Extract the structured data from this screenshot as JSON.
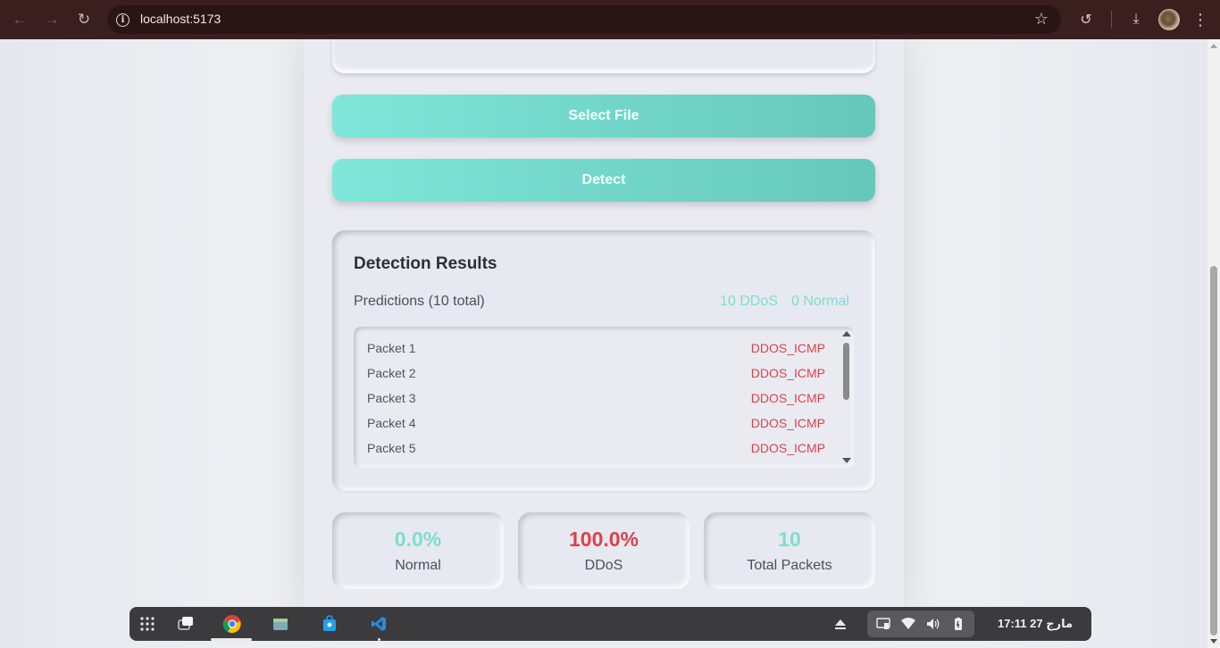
{
  "browser": {
    "url": "localhost:5173"
  },
  "actions": {
    "select_file_label": "Select File",
    "detect_label": "Detect"
  },
  "results": {
    "title": "Detection Results",
    "predictions_label": "Predictions (10 total)",
    "ddos_count_label": "10 DDoS",
    "normal_count_label": "0 Normal",
    "packets": [
      {
        "name": "Packet 1",
        "type": "DDOS_ICMP"
      },
      {
        "name": "Packet 2",
        "type": "DDOS_ICMP"
      },
      {
        "name": "Packet 3",
        "type": "DDOS_ICMP"
      },
      {
        "name": "Packet 4",
        "type": "DDOS_ICMP"
      },
      {
        "name": "Packet 5",
        "type": "DDOS_ICMP"
      }
    ]
  },
  "stats": {
    "normal": {
      "value": "0.0%",
      "label": "Normal",
      "color": "#7fdcd1"
    },
    "ddos": {
      "value": "100.0%",
      "label": "DDoS",
      "color": "#e0404a"
    },
    "total": {
      "value": "10",
      "label": "Total Packets",
      "color": "#7fdcd1"
    }
  },
  "taskbar": {
    "clock": "17:11  27 مارج"
  },
  "colors": {
    "accent": "#6fd4c6",
    "ddos_red": "#e0404a"
  }
}
